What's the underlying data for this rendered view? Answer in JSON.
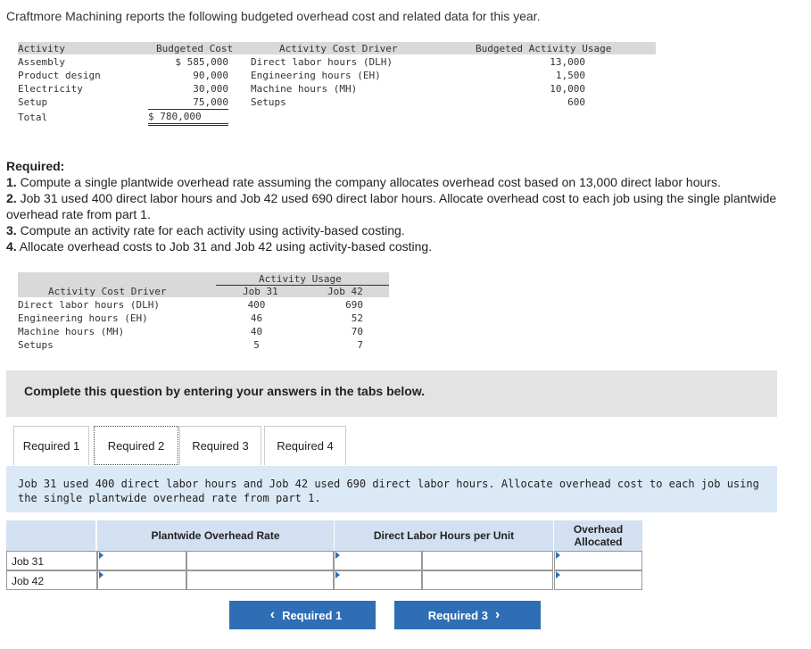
{
  "intro": "Craftmore Machining reports the following budgeted overhead cost and related data for this year.",
  "budget_table": {
    "headers": [
      "Activity",
      "Budgeted Cost",
      "Activity Cost Driver",
      "Budgeted Activity Usage"
    ],
    "rows": [
      {
        "activity": "Assembly",
        "cost": "$ 585,000",
        "driver": "Direct labor hours (DLH)",
        "usage": "13,000"
      },
      {
        "activity": "Product design",
        "cost": "90,000",
        "driver": "Engineering hours (EH)",
        "usage": "1,500"
      },
      {
        "activity": "Electricity",
        "cost": "30,000",
        "driver": "Machine hours (MH)",
        "usage": "10,000"
      },
      {
        "activity": "Setup",
        "cost": "75,000",
        "driver": "Setups",
        "usage": "600"
      }
    ],
    "total_label": "Total",
    "total_cost": "$ 780,000"
  },
  "required": {
    "heading": "Required:",
    "items": [
      {
        "num": "1.",
        "text": " Compute a single plantwide overhead rate assuming the company allocates overhead cost based on 13,000 direct labor hours."
      },
      {
        "num": "2.",
        "text": " Job 31 used 400 direct labor hours and Job 42 used 690 direct labor hours. Allocate overhead cost to each job using the single plantwide overhead rate from part 1."
      },
      {
        "num": "3.",
        "text": " Compute an activity rate for each activity using activity-based costing."
      },
      {
        "num": "4.",
        "text": " Allocate overhead costs to Job 31 and Job 42 using activity-based costing."
      }
    ]
  },
  "usage_table": {
    "group_header": "Activity Usage",
    "driver_header": "Activity Cost Driver",
    "col_headers": [
      "Job 31",
      "Job 42"
    ],
    "rows": [
      {
        "driver": "Direct labor hours (DLH)",
        "job31": "400",
        "job42": "690"
      },
      {
        "driver": "Engineering hours (EH)",
        "job31": "46",
        "job42": "52"
      },
      {
        "driver": "Machine hours (MH)",
        "job31": "40",
        "job42": "70"
      },
      {
        "driver": "Setups",
        "job31": "5",
        "job42": "7"
      }
    ]
  },
  "complete_prompt": "Complete this question by entering your answers in the tabs below.",
  "tabs": [
    {
      "label": "Required 1",
      "active": false
    },
    {
      "label": "Required 2",
      "active": true
    },
    {
      "label": "Required 3",
      "active": false
    },
    {
      "label": "Required 4",
      "active": false
    }
  ],
  "panel_instruction": "Job 31 used 400 direct labor hours and Job 42 used 690 direct labor hours. Allocate overhead cost to each job using the single plantwide overhead rate from part 1.",
  "answer_table": {
    "headers": [
      "Plantwide Overhead Rate",
      "Direct Labor Hours per Unit",
      "Overhead Allocated"
    ],
    "rows": [
      {
        "label": "Job 31",
        "rate_value": "",
        "rate_unit_value": "",
        "hours_value": "",
        "hours_extra_value": "",
        "allocated_value": ""
      },
      {
        "label": "Job 42",
        "rate_value": "",
        "rate_unit_value": "",
        "hours_value": "",
        "hours_extra_value": "",
        "allocated_value": ""
      }
    ]
  },
  "nav": {
    "prev_label": "Required 1",
    "next_label": "Required 3",
    "prev_icon": "chevron-left-icon",
    "next_icon": "chevron-right-icon"
  },
  "colors": {
    "accent": "#2f6eb5",
    "header_gray": "#d9d9d9",
    "panel_blue": "#dbe9f7",
    "answer_header": "#d2e0f1"
  }
}
